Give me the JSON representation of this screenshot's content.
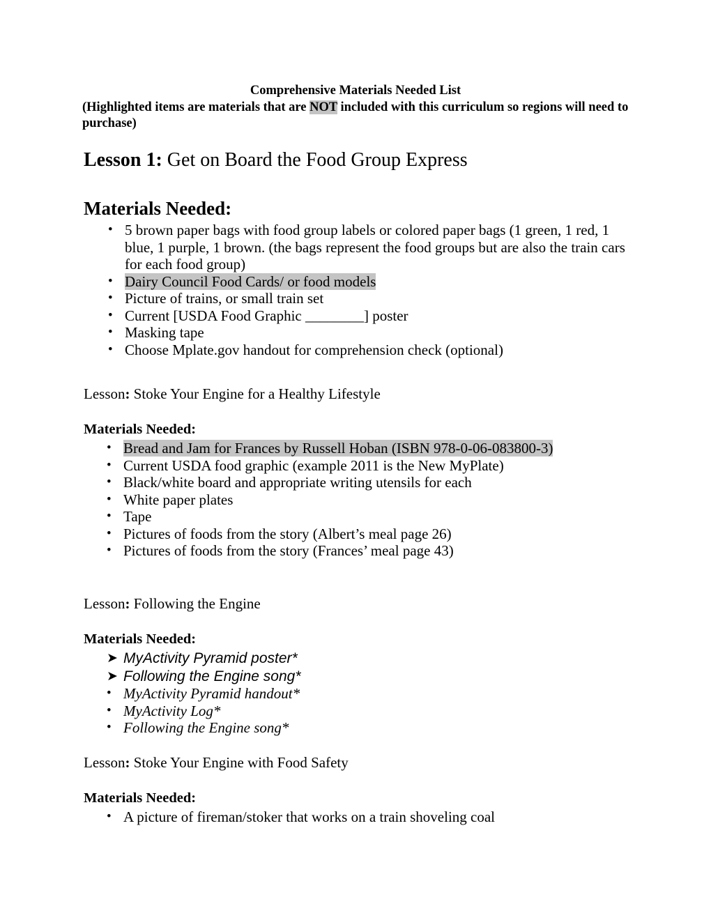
{
  "document": {
    "title": "Comprehensive Materials Needed List",
    "subtitle_before": "(Highlighted items are materials that are ",
    "subtitle_highlight": "NOT",
    "subtitle_after": " included with this curriculum so regions will need to purchase)",
    "highlight_color": "#c4c4c4"
  },
  "lesson_one": {
    "label": "Lesson 1:",
    "title": " Get on Board the Food Group Express",
    "materials_heading": "Materials Needed:",
    "items": [
      {
        "text": "5 brown paper bags with food group labels or colored paper bags (1 green, 1 red, 1 blue, 1 purple, 1 brown. (the bags represent the food groups but are also the train cars for each food group)",
        "bullet": "bullet-dot",
        "highlighted": false
      },
      {
        "text": "Dairy Council Food Cards/ or food models",
        "bullet": "bullet-dot",
        "highlighted": true
      },
      {
        "text": "Picture of trains, or small train set",
        "bullet": "bullet-dot",
        "highlighted": false
      },
      {
        "text": "Current [USDA Food Graphic ________] poster",
        "bullet": "bullet-dot",
        "highlighted": false
      },
      {
        "text": "Masking tape",
        "bullet": "bullet-dot",
        "highlighted": false
      },
      {
        "text": "Choose Mplate.gov handout for comprehension check (optional)",
        "bullet": "bullet-dot",
        "highlighted": false
      }
    ]
  },
  "sections": [
    {
      "lesson_label": "Lesson",
      "lesson_colon": ":",
      "lesson_title": " Stoke Your Engine for a Healthy Lifestyle",
      "materials_heading": "Materials Needed:",
      "items": [
        {
          "text": "Bread and Jam for Frances by Russell Hoban (ISBN 978-0-06-083800-3)",
          "bullet": "bullet-dot",
          "highlighted": true,
          "style": "normal"
        },
        {
          "text": "Current USDA food graphic (example 2011 is the New MyPlate)",
          "bullet": "bullet-dot",
          "highlighted": false,
          "style": "normal"
        },
        {
          "text": "Black/white board and appropriate writing utensils for each",
          "bullet": "bullet-dot",
          "highlighted": false,
          "style": "normal"
        },
        {
          "text": "White paper plates",
          "bullet": "bullet-dot",
          "highlighted": false,
          "style": "normal"
        },
        {
          "text": "Tape",
          "bullet": "bullet-dot",
          "highlighted": false,
          "style": "normal"
        },
        {
          "text": "Pictures of foods from the story (Albert’s meal page 26)",
          "bullet": "bullet-dot",
          "highlighted": false,
          "style": "normal"
        },
        {
          "text": "Pictures of foods from the story (Frances’ meal page 43)",
          "bullet": "bullet-dot",
          "highlighted": false,
          "style": "normal"
        }
      ]
    },
    {
      "lesson_label": "Lesson",
      "lesson_colon": ":",
      "lesson_title": "  Following the Engine",
      "materials_heading": "Materials Needed:",
      "items": [
        {
          "text": "MyActivity Pyramid poster*",
          "bullet": "arrow-head",
          "highlighted": false,
          "style": "italic-sans"
        },
        {
          "text": "Following the Engine song*",
          "bullet": "arrow-head",
          "highlighted": false,
          "style": "italic-sans"
        },
        {
          "text": " MyActivity Pyramid handout*",
          "bullet": "bullet-dot",
          "highlighted": false,
          "style": "italic-serif"
        },
        {
          "text": "MyActivity Log*",
          "bullet": "bullet-dot",
          "highlighted": false,
          "style": "italic-serif"
        },
        {
          "text": "Following the Engine song*",
          "bullet": "bullet-dot",
          "highlighted": false,
          "style": "italic-serif"
        }
      ]
    },
    {
      "lesson_label": "Lesson",
      "lesson_colon": ":",
      "lesson_title": "  Stoke Your Engine with Food Safety",
      "materials_heading": "Materials Needed:",
      "items": [
        {
          "text": "A picture of fireman/stoker that works on a train shoveling  coal",
          "bullet": "bullet-dot",
          "highlighted": false,
          "style": "normal"
        }
      ]
    }
  ],
  "glyphs": {
    "bullet_dot": "•",
    "arrow_head": "➤"
  }
}
